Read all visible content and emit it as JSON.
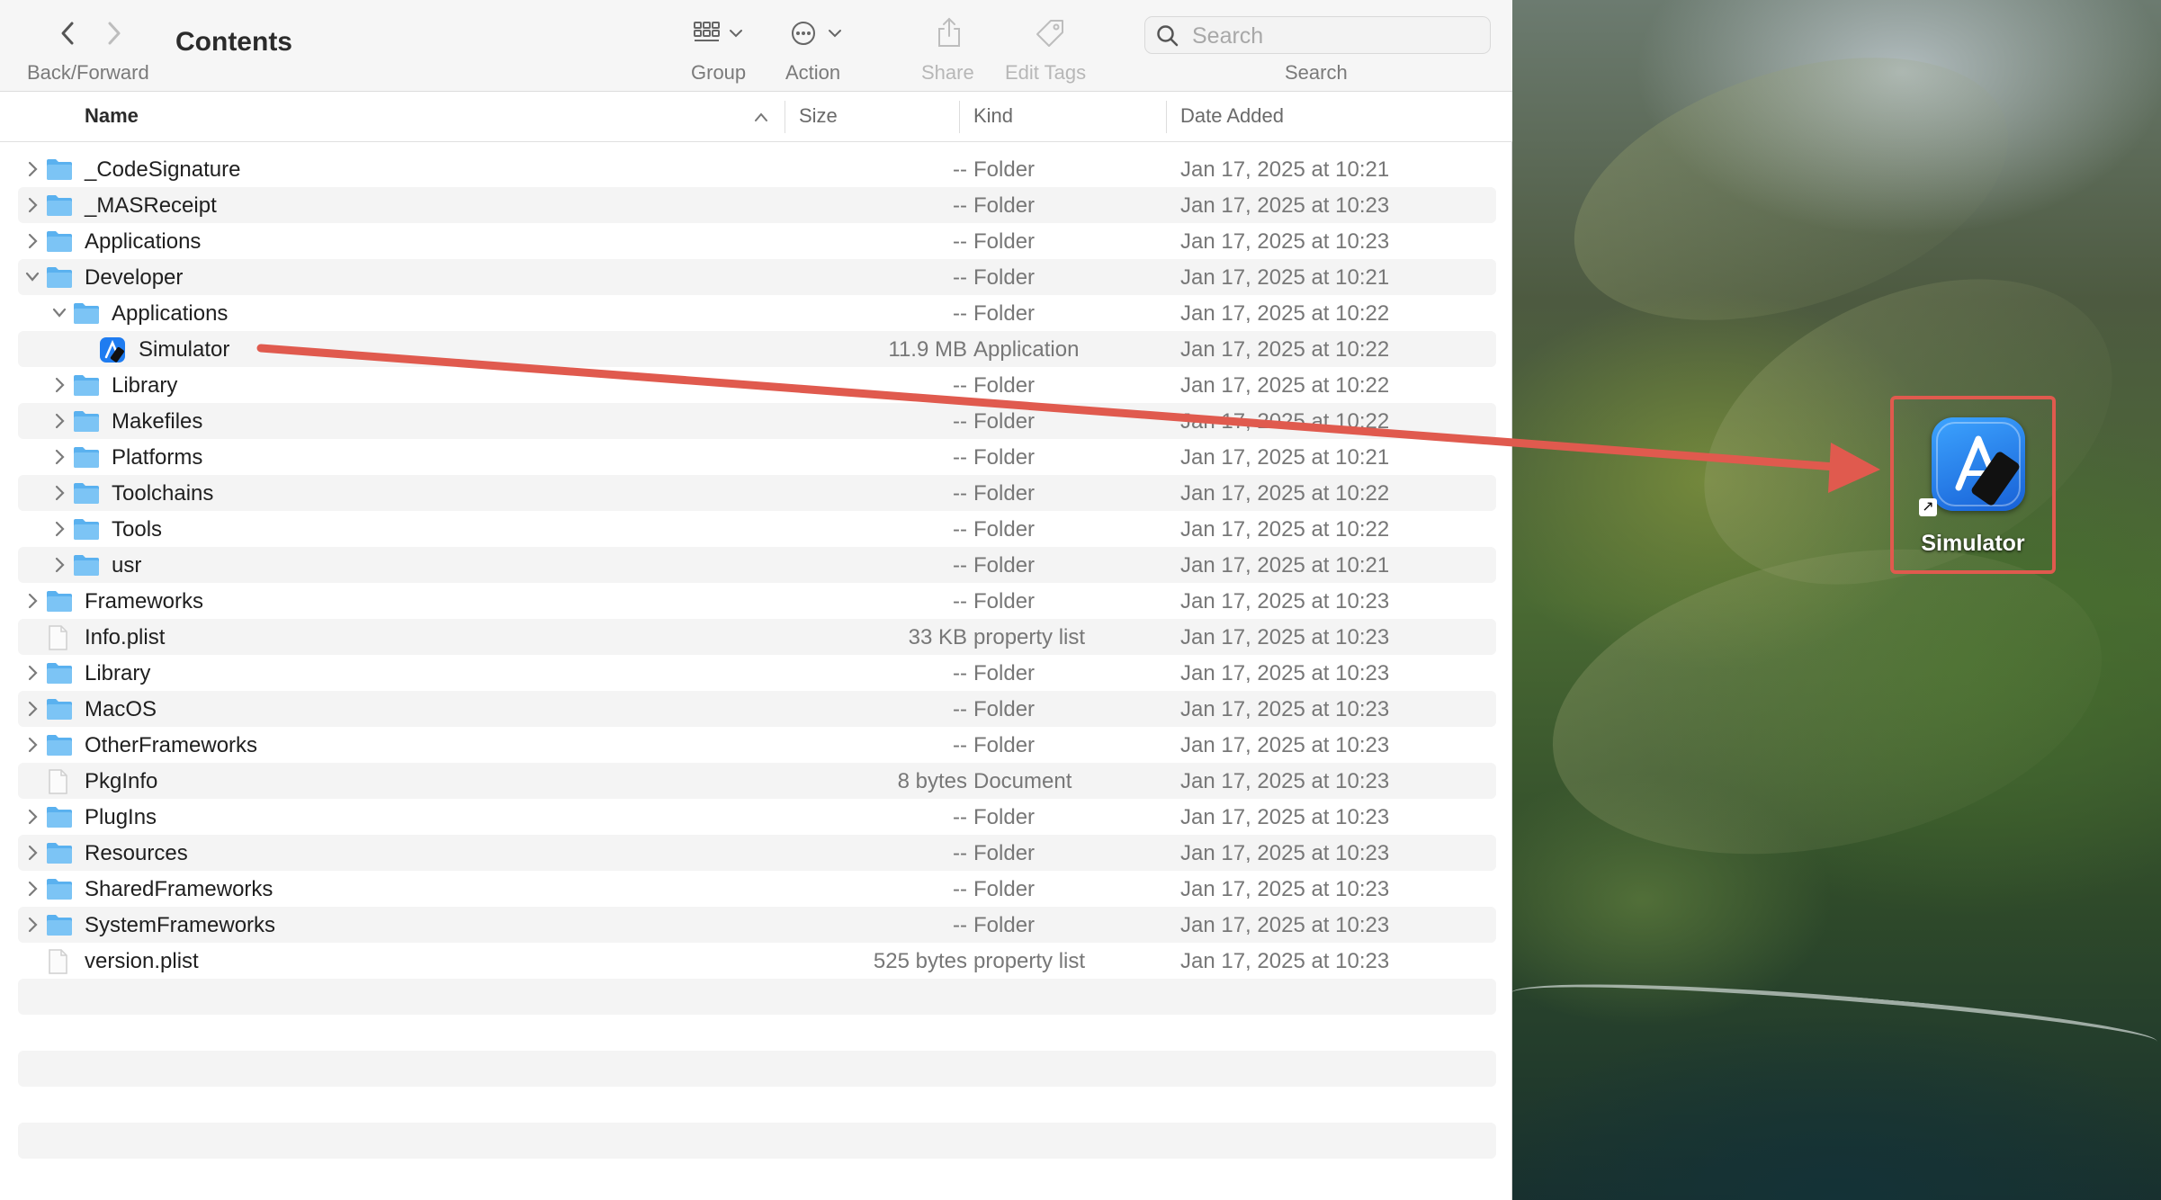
{
  "window": {
    "title": "Contents",
    "nav_label": "Back/Forward"
  },
  "toolbar": {
    "group_label": "Group",
    "action_label": "Action",
    "share_label": "Share",
    "edit_tags_label": "Edit Tags",
    "search_label": "Search",
    "search_placeholder": "Search",
    "icons": [
      "chevron-left-icon",
      "chevron-right-icon",
      "grid-icon",
      "more-icon",
      "share-icon",
      "tag-icon",
      "search-icon"
    ]
  },
  "columns": {
    "name": "Name",
    "size": "Size",
    "kind": "Kind",
    "date_added": "Date Added"
  },
  "files": [
    {
      "name": "_CodeSignature",
      "size": "--",
      "kind": "Folder",
      "date": "Jan 17, 2025 at 10:21",
      "level": 0,
      "type": "folder",
      "expanded": false
    },
    {
      "name": "_MASReceipt",
      "size": "--",
      "kind": "Folder",
      "date": "Jan 17, 2025 at 10:23",
      "level": 0,
      "type": "folder",
      "expanded": false
    },
    {
      "name": "Applications",
      "size": "--",
      "kind": "Folder",
      "date": "Jan 17, 2025 at 10:23",
      "level": 0,
      "type": "folder",
      "expanded": false
    },
    {
      "name": "Developer",
      "size": "--",
      "kind": "Folder",
      "date": "Jan 17, 2025 at 10:21",
      "level": 0,
      "type": "folder",
      "expanded": true
    },
    {
      "name": "Applications",
      "size": "--",
      "kind": "Folder",
      "date": "Jan 17, 2025 at 10:22",
      "level": 1,
      "type": "folder",
      "expanded": true
    },
    {
      "name": "Simulator",
      "size": "11.9 MB",
      "kind": "Application",
      "date": "Jan 17, 2025 at 10:22",
      "level": 2,
      "type": "app",
      "expanded": false
    },
    {
      "name": "Library",
      "size": "--",
      "kind": "Folder",
      "date": "Jan 17, 2025 at 10:22",
      "level": 1,
      "type": "folder",
      "expanded": false
    },
    {
      "name": "Makefiles",
      "size": "--",
      "kind": "Folder",
      "date": "Jan 17, 2025 at 10:22",
      "level": 1,
      "type": "folder",
      "expanded": false
    },
    {
      "name": "Platforms",
      "size": "--",
      "kind": "Folder",
      "date": "Jan 17, 2025 at 10:21",
      "level": 1,
      "type": "folder",
      "expanded": false
    },
    {
      "name": "Toolchains",
      "size": "--",
      "kind": "Folder",
      "date": "Jan 17, 2025 at 10:22",
      "level": 1,
      "type": "folder",
      "expanded": false
    },
    {
      "name": "Tools",
      "size": "--",
      "kind": "Folder",
      "date": "Jan 17, 2025 at 10:22",
      "level": 1,
      "type": "folder",
      "expanded": false
    },
    {
      "name": "usr",
      "size": "--",
      "kind": "Folder",
      "date": "Jan 17, 2025 at 10:21",
      "level": 1,
      "type": "folder",
      "expanded": false
    },
    {
      "name": "Frameworks",
      "size": "--",
      "kind": "Folder",
      "date": "Jan 17, 2025 at 10:23",
      "level": 0,
      "type": "folder",
      "expanded": false
    },
    {
      "name": "Info.plist",
      "size": "33 KB",
      "kind": "property list",
      "date": "Jan 17, 2025 at 10:23",
      "level": 0,
      "type": "file",
      "expanded": false
    },
    {
      "name": "Library",
      "size": "--",
      "kind": "Folder",
      "date": "Jan 17, 2025 at 10:23",
      "level": 0,
      "type": "folder",
      "expanded": false
    },
    {
      "name": "MacOS",
      "size": "--",
      "kind": "Folder",
      "date": "Jan 17, 2025 at 10:23",
      "level": 0,
      "type": "folder",
      "expanded": false
    },
    {
      "name": "OtherFrameworks",
      "size": "--",
      "kind": "Folder",
      "date": "Jan 17, 2025 at 10:23",
      "level": 0,
      "type": "folder",
      "expanded": false
    },
    {
      "name": "PkgInfo",
      "size": "8 bytes",
      "kind": "Document",
      "date": "Jan 17, 2025 at 10:23",
      "level": 0,
      "type": "file",
      "expanded": false
    },
    {
      "name": "PlugIns",
      "size": "--",
      "kind": "Folder",
      "date": "Jan 17, 2025 at 10:23",
      "level": 0,
      "type": "folder",
      "expanded": false
    },
    {
      "name": "Resources",
      "size": "--",
      "kind": "Folder",
      "date": "Jan 17, 2025 at 10:23",
      "level": 0,
      "type": "folder",
      "expanded": false
    },
    {
      "name": "SharedFrameworks",
      "size": "--",
      "kind": "Folder",
      "date": "Jan 17, 2025 at 10:23",
      "level": 0,
      "type": "folder",
      "expanded": false
    },
    {
      "name": "SystemFrameworks",
      "size": "--",
      "kind": "Folder",
      "date": "Jan 17, 2025 at 10:23",
      "level": 0,
      "type": "folder",
      "expanded": false
    },
    {
      "name": "version.plist",
      "size": "525 bytes",
      "kind": "property list",
      "date": "Jan 17, 2025 at 10:23",
      "level": 0,
      "type": "file",
      "expanded": false
    }
  ],
  "desktop": {
    "shortcut_label": "Simulator",
    "shortcut_icon": "simulator-app-icon"
  },
  "colors": {
    "folder": "#5ab1ef",
    "annotation": "#e05a4e",
    "app_icon": "#1f7cf0"
  }
}
